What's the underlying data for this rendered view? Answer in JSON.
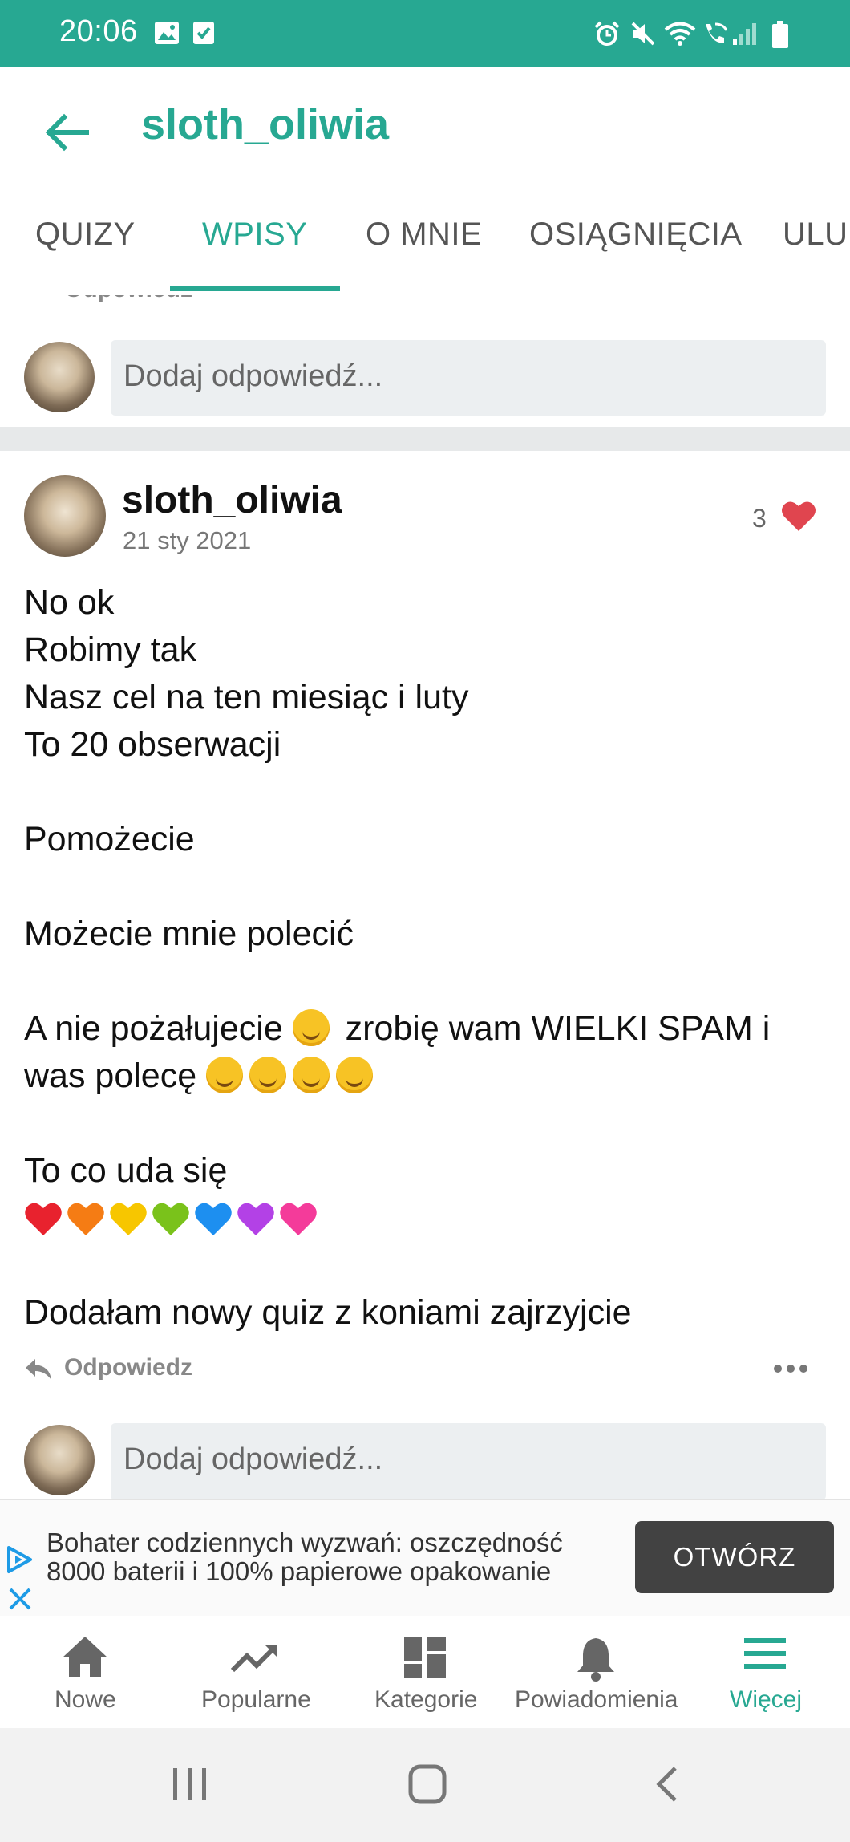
{
  "status_bar": {
    "time": "20:06",
    "color": "#27a892",
    "icons": [
      "image-icon",
      "check-box-icon",
      "alarm-icon",
      "mute-icon",
      "wifi-icon",
      "wifi-call-icon",
      "signal-icon",
      "battery-icon"
    ]
  },
  "app_bar": {
    "title": "sloth_oliwia",
    "back_icon": "arrow-back-icon"
  },
  "tabs": [
    {
      "label": "QUIZY",
      "active": false
    },
    {
      "label": "WPISY",
      "active": true
    },
    {
      "label": "O MNIE",
      "active": false
    },
    {
      "label": "OSIĄGNIĘCIA",
      "active": false
    },
    {
      "label": "ULUB",
      "active": false
    }
  ],
  "top_reply": {
    "partial_label": "Odpowiedz",
    "placeholder": "Dodaj odpowiedź..."
  },
  "post": {
    "author": "sloth_oliwia",
    "date": "21 sty 2021",
    "likes": "3",
    "lines": {
      "l1": "No ok",
      "l2": "Robimy tak",
      "l3": "Nasz cel na ten miesiąc i luty",
      "l4": "To 20 obserwacji",
      "l5": "Pomożecie",
      "l6": "Możecie mnie polecić",
      "l7a": "A nie pożałujecie",
      "l7b": "zrobię wam WIELKI SPAM i",
      "l8": "was polecę",
      "l9": "To co uda się",
      "l10": "Dodałam nowy quiz z koniami zajrzyjcie"
    },
    "emoji_line1": [
      "wink-emoji"
    ],
    "emoji_line2": [
      "smile-emoji",
      "smile-emoji",
      "grin-emoji",
      "grin-emoji"
    ],
    "hearts": [
      "#e8222e",
      "#f57c14",
      "#f7c600",
      "#7ac21b",
      "#1d8ff0",
      "#b341e6",
      "#f43b9a"
    ],
    "reply_label": "Odpowiedz",
    "reply_placeholder": "Dodaj odpowiedź..."
  },
  "ad": {
    "line1": "Bohater codziennych wyzwań: oszczędność",
    "line2": "8000 baterii i 100% papierowe opakowanie",
    "button": "OTWÓRZ"
  },
  "bottom_nav": [
    {
      "label": "Nowe",
      "icon": "home-icon",
      "active": false
    },
    {
      "label": "Popularne",
      "icon": "trending-icon",
      "active": false
    },
    {
      "label": "Kategorie",
      "icon": "dashboard-icon",
      "active": false
    },
    {
      "label": "Powiadomienia",
      "icon": "bell-icon",
      "active": false
    },
    {
      "label": "Więcej",
      "icon": "menu-icon",
      "active": true
    }
  ],
  "accent_color": "#27a892"
}
